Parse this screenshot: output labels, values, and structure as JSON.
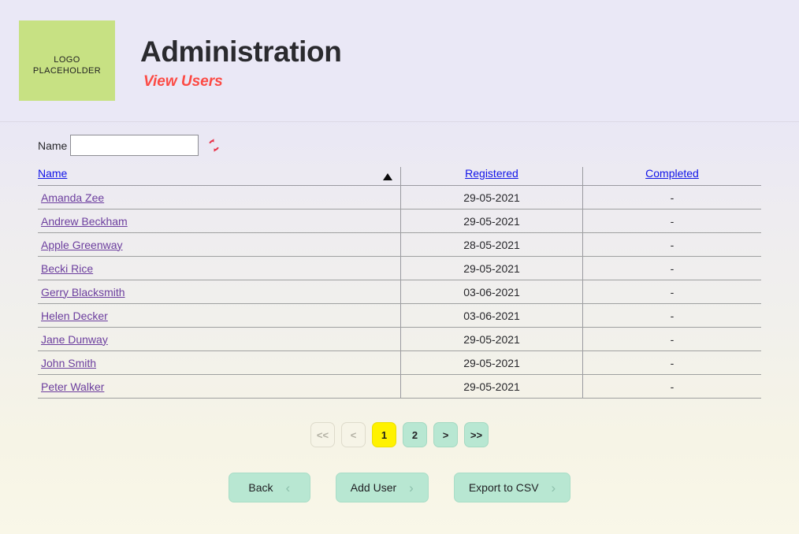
{
  "header": {
    "logo_text_line1": "LOGO",
    "logo_text_line2": "PLACEHOLDER",
    "title": "Administration",
    "subtitle": "View Users",
    "logo_color": "#c7e183",
    "subtitle_color": "#fc4a44"
  },
  "filter": {
    "name_label": "Name",
    "name_value": "",
    "name_placeholder": "",
    "refresh_icon": "refresh-icon",
    "refresh_color": "#e8334a"
  },
  "table": {
    "columns": [
      {
        "label": "Name",
        "sorted": true,
        "sort_direction": "asc"
      },
      {
        "label": "Registered",
        "sorted": false,
        "sort_direction": ""
      },
      {
        "label": "Completed",
        "sorted": false,
        "sort_direction": ""
      }
    ],
    "rows": [
      {
        "name": "Amanda Zee",
        "registered": "29-05-2021",
        "completed": "-"
      },
      {
        "name": "Andrew Beckham",
        "registered": "29-05-2021",
        "completed": "-"
      },
      {
        "name": "Apple Greenway",
        "registered": "28-05-2021",
        "completed": "-"
      },
      {
        "name": "Becki Rice",
        "registered": "29-05-2021",
        "completed": "-"
      },
      {
        "name": "Gerry Blacksmith",
        "registered": "03-06-2021",
        "completed": "-"
      },
      {
        "name": "Helen Decker",
        "registered": "03-06-2021",
        "completed": "-"
      },
      {
        "name": "Jane Dunway",
        "registered": "29-05-2021",
        "completed": "-"
      },
      {
        "name": "John Smith",
        "registered": "29-05-2021",
        "completed": "-"
      },
      {
        "name": "Peter Walker",
        "registered": "29-05-2021",
        "completed": "-"
      }
    ]
  },
  "pagination": {
    "current_page": "1",
    "buttons": [
      {
        "label": "<<",
        "state": "disabled",
        "name": "first-page-button"
      },
      {
        "label": "<",
        "state": "disabled",
        "name": "previous-page-button"
      },
      {
        "label": "1",
        "state": "active",
        "name": "page-1-button"
      },
      {
        "label": "2",
        "state": "mint",
        "name": "page-2-button"
      },
      {
        "label": ">",
        "state": "mint",
        "name": "next-page-button"
      },
      {
        "label": ">>",
        "state": "mint",
        "name": "last-page-button"
      }
    ]
  },
  "actions": [
    {
      "label": "Back",
      "chevron": "‹",
      "name": "back-button"
    },
    {
      "label": "Add User",
      "chevron": "›",
      "name": "add-user-button"
    },
    {
      "label": "Export to CSV",
      "chevron": "›",
      "name": "export-to-csv-button"
    }
  ]
}
